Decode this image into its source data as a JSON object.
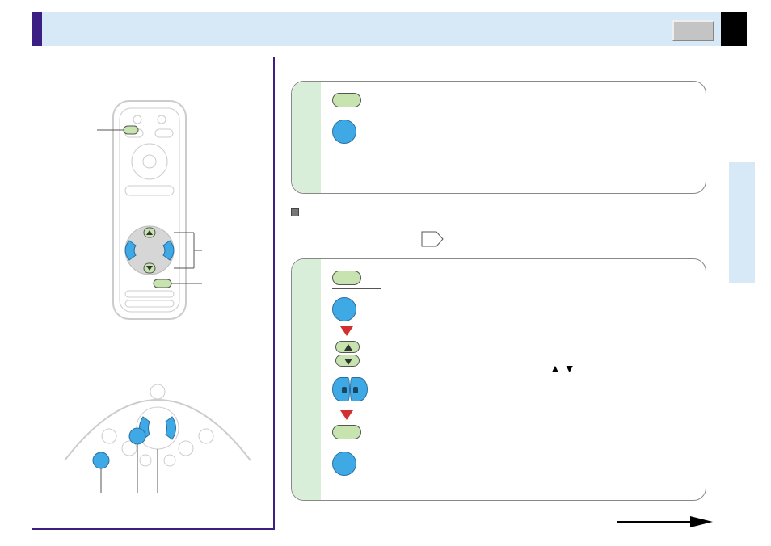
{
  "header": {
    "title": ""
  },
  "page": {
    "number": ""
  },
  "left": {
    "remote": {
      "labels": {
        "top_button": "",
        "arrow_group": "",
        "lower_button": ""
      }
    },
    "panel": {
      "labels": {
        "button_a": "",
        "button_b": ""
      }
    }
  },
  "note": {
    "text": ""
  },
  "polygon_label": {
    "text": ""
  },
  "box1": {
    "pill_label": "",
    "circle_label": ""
  },
  "box2": {
    "pill_label": "",
    "circle_label": "",
    "up_down_marker": "▲ ▼",
    "final_pill_label": "",
    "final_circle_label": ""
  },
  "continued": {
    "text": ""
  }
}
